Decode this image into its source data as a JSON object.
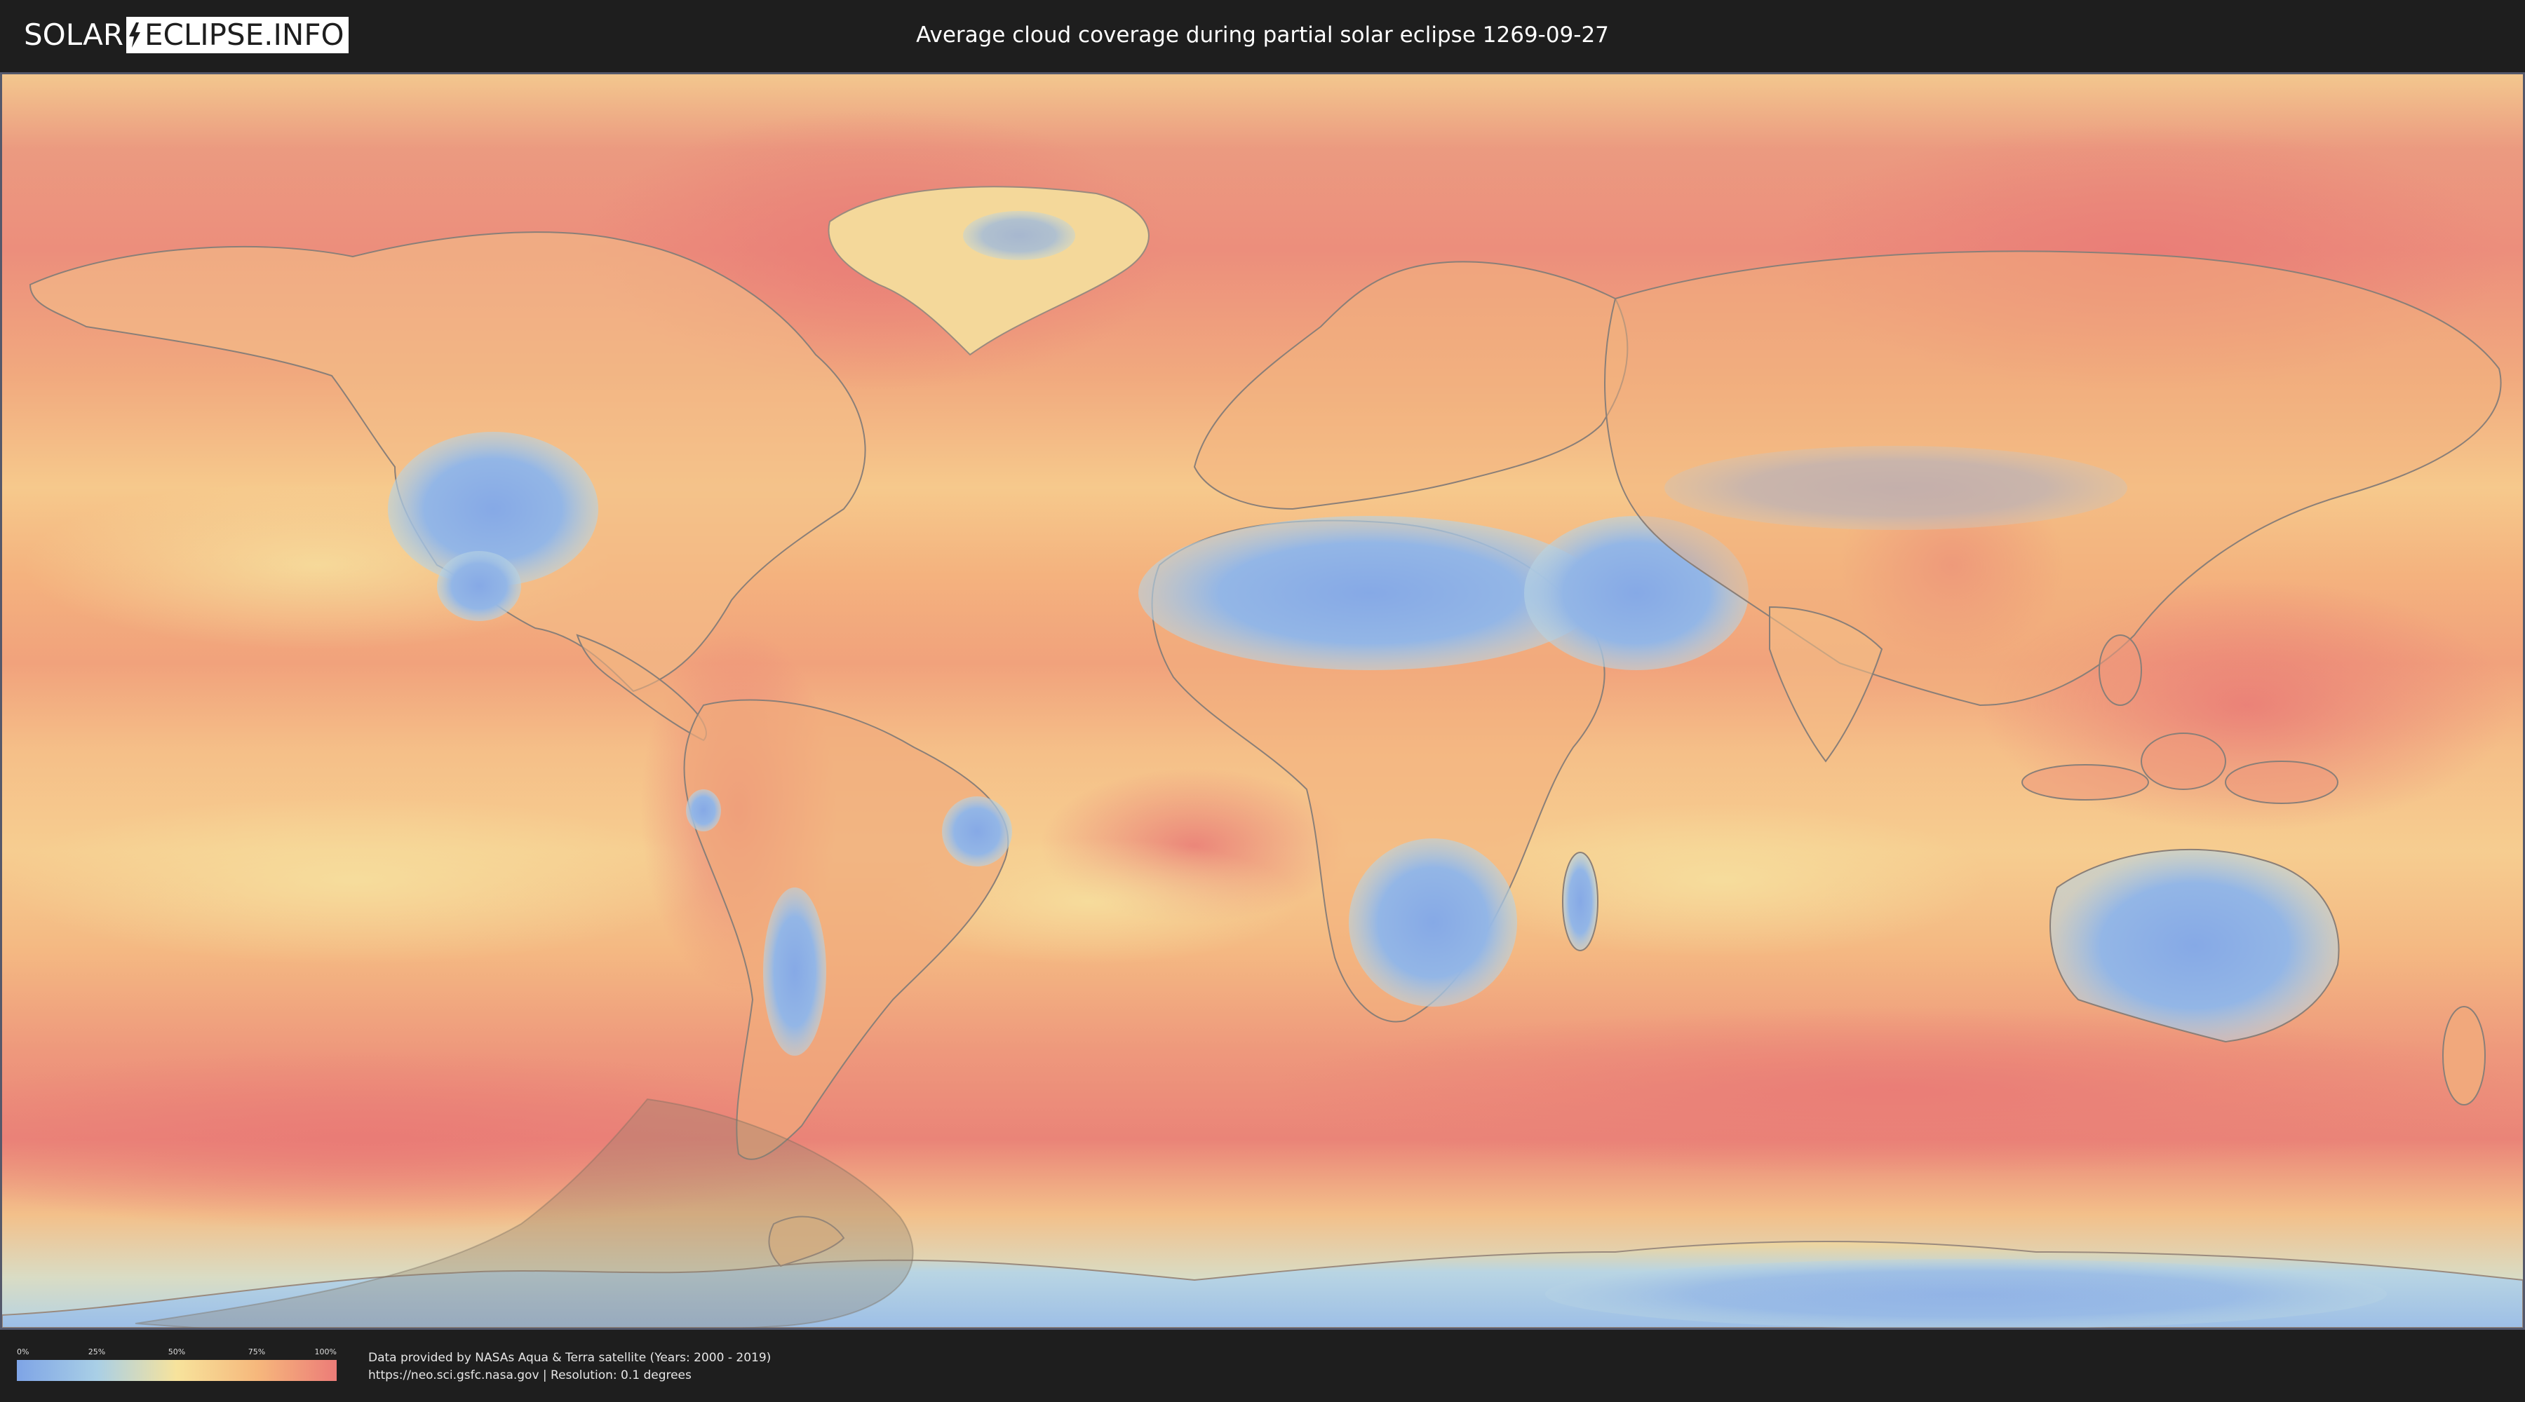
{
  "header": {
    "logo_left": "SOLAR",
    "logo_right": "ECLIPSE.INFO",
    "title": "Average cloud coverage during partial solar eclipse 1269-09-27"
  },
  "map": {
    "eclipse_shadow_color": "#8c7f6c",
    "ocean_cloud_color": "#f2a874",
    "land_outline_color": "#8a7f78"
  },
  "legend": {
    "ticks": [
      "0%",
      "25%",
      "50%",
      "75%",
      "100%"
    ],
    "colors": {
      "low": "#7ea4e6",
      "mid_low": "#a9cfe6",
      "mid": "#f7e39c",
      "mid_high": "#f6b87c",
      "high": "#ec7c78"
    }
  },
  "footer": {
    "credit_line_1": "Data provided by NASAs Aqua & Terra satellite (Years: 2000 - 2019)",
    "credit_line_2": "https://neo.sci.gsfc.nasa.gov | Resolution: 0.1 degrees"
  }
}
